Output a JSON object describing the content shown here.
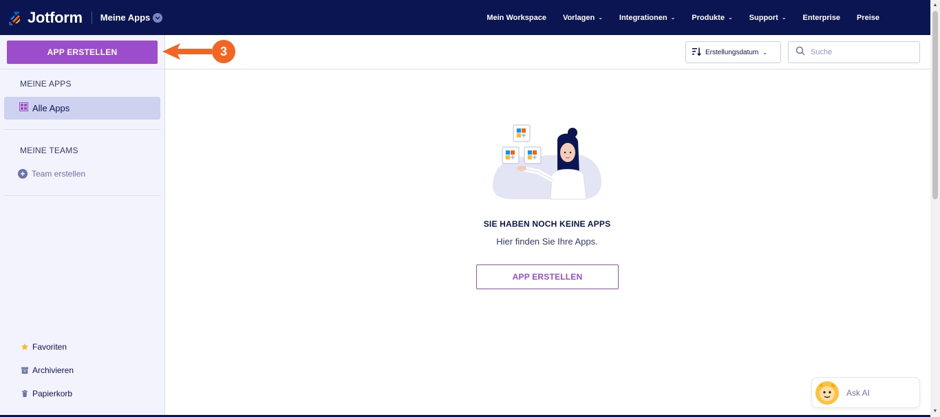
{
  "topbar": {
    "brand": "Jotform",
    "section_title": "Meine Apps",
    "nav": [
      {
        "label": "Mein Workspace",
        "dropdown": false
      },
      {
        "label": "Vorlagen",
        "dropdown": true
      },
      {
        "label": "Integrationen",
        "dropdown": true
      },
      {
        "label": "Produkte",
        "dropdown": true
      },
      {
        "label": "Support",
        "dropdown": true
      },
      {
        "label": "Enterprise",
        "dropdown": false
      },
      {
        "label": "Preise",
        "dropdown": false
      }
    ]
  },
  "sidebar": {
    "create_label": "APP ERSTELLEN",
    "my_apps_heading": "MEINE APPS",
    "all_apps_label": "Alle Apps",
    "my_teams_heading": "MEINE TEAMS",
    "team_create_label": "Team erstellen",
    "bottom_items": [
      {
        "label": "Favoriten",
        "icon": "star-icon"
      },
      {
        "label": "Archivieren",
        "icon": "archive-icon"
      },
      {
        "label": "Papierkorb",
        "icon": "trash-icon"
      }
    ]
  },
  "toolbar": {
    "sort_label": "Erstellungsdatum",
    "search_placeholder": "Suche"
  },
  "empty_state": {
    "title": "SIE HABEN NOCH KEINE APPS",
    "subtitle": "Hier finden Sie Ihre Apps.",
    "button_label": "APP ERSTELLEN"
  },
  "annotation": {
    "step_number": "3"
  },
  "ask_ai": {
    "label": "Ask AI"
  },
  "colors": {
    "navbar": "#0a1551",
    "accent_purple": "#9c4dcc",
    "annotation_orange": "#f26522",
    "sidebar_bg": "#f3f3fe",
    "active_item_bg": "#cdd2f0"
  }
}
